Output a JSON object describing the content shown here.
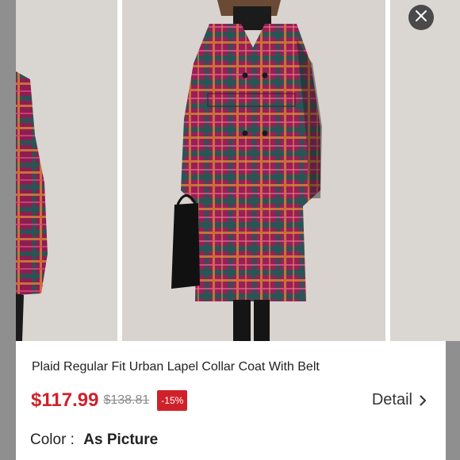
{
  "product": {
    "title": "Plaid Regular Fit Urban Lapel Collar Coat With Belt",
    "price": "$117.99",
    "original_price": "$138.81",
    "discount": "-15%",
    "detail_label": "Detail",
    "color_label": "Color :",
    "color_value": "As Picture"
  },
  "icons": {
    "close": "close-icon",
    "detail_arrow": "chevron-right-icon"
  },
  "colors": {
    "price": "#d0212a",
    "discount_bg": "#d0212a",
    "overlay": "#8f8f8f",
    "coat_magenta": "#9a1f57",
    "coat_green": "#1f5a55",
    "coat_orange": "#c9703a"
  }
}
